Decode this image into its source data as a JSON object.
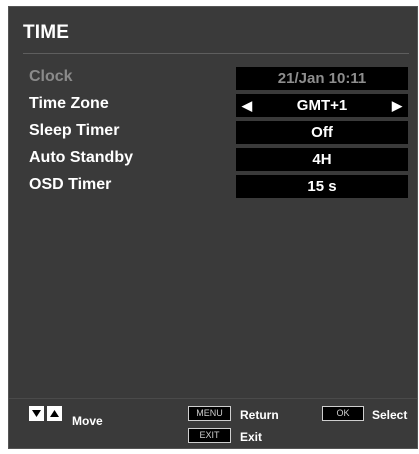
{
  "menu": {
    "title": "TIME",
    "rows": [
      {
        "label": "Clock",
        "value": "21/Jan  10:11"
      },
      {
        "label": "Time Zone",
        "value": "GMT+1"
      },
      {
        "label": "Sleep Timer",
        "value": "Off"
      },
      {
        "label": "Auto Standby",
        "value": "4H"
      },
      {
        "label": "OSD Timer",
        "value": "15 s"
      }
    ]
  },
  "footer": {
    "move_label": "Move",
    "menu_key": "MENU",
    "return_label": "Return",
    "exit_key": "EXIT",
    "exit_label": "Exit",
    "ok_key": "OK",
    "select_label": "Select"
  },
  "icons": {
    "left_arrow": "left-triangle",
    "right_arrow": "right-triangle",
    "nav_down": "down-triangle",
    "nav_up": "up-triangle"
  }
}
